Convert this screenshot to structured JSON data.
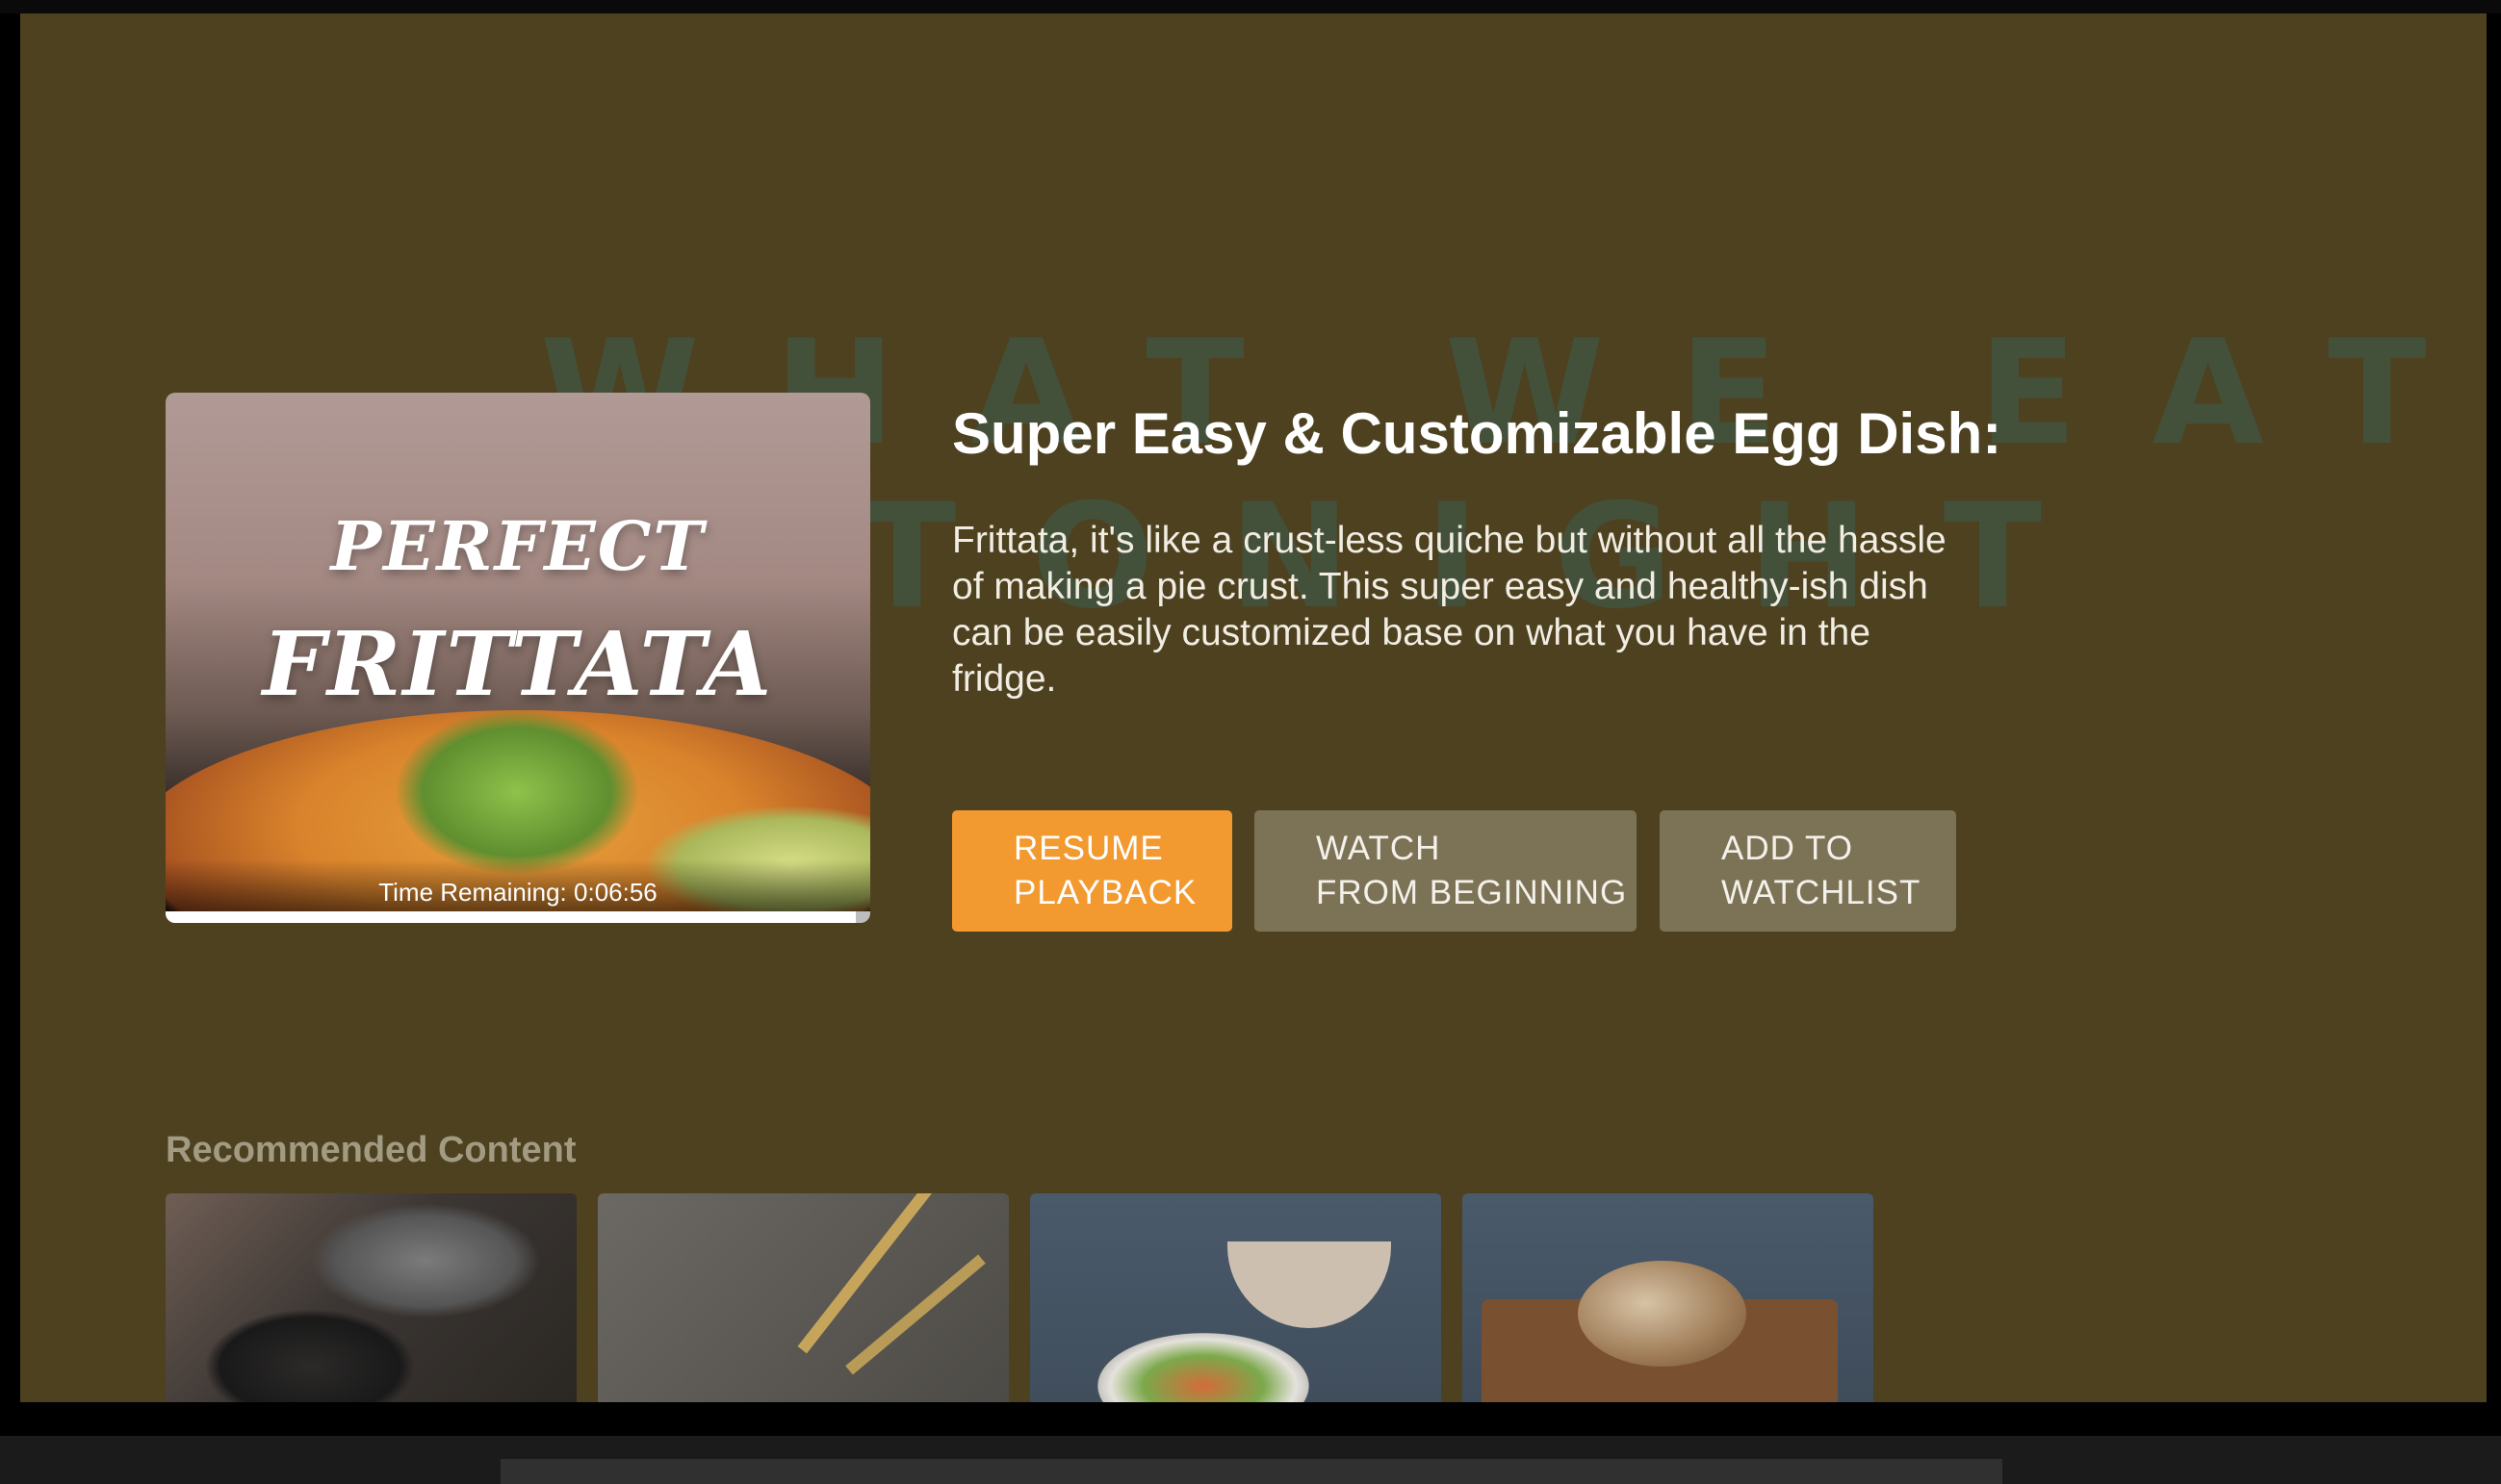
{
  "thumbnail": {
    "title_line1": "PERFECT",
    "title_line2": "FRITTATA",
    "time_remaining": "Time Remaining: 0:06:56",
    "progress": 0.98
  },
  "details": {
    "title": "Super Easy & Customizable Egg Dish: F...",
    "description": "Frittata, it's like a crust-less quiche but without all the hassle of making a pie crust. This super easy and healthy-ish dish can be easily customized base on what you have in the fridge."
  },
  "actions": {
    "resume": [
      "RESUME",
      "PLAYBACK"
    ],
    "watch": [
      "WATCH",
      "FROM BEGINNING"
    ],
    "watchlist": [
      "ADD TO",
      "WATCHLIST"
    ]
  },
  "recommended": {
    "title": "Recommended Content",
    "items": [
      "cooking-pans",
      "knives",
      "salad-bowl",
      "bread-board"
    ]
  },
  "colors": {
    "background": "#4d4120",
    "primary_button": "#f29a30",
    "secondary_button": "#7c7357"
  }
}
